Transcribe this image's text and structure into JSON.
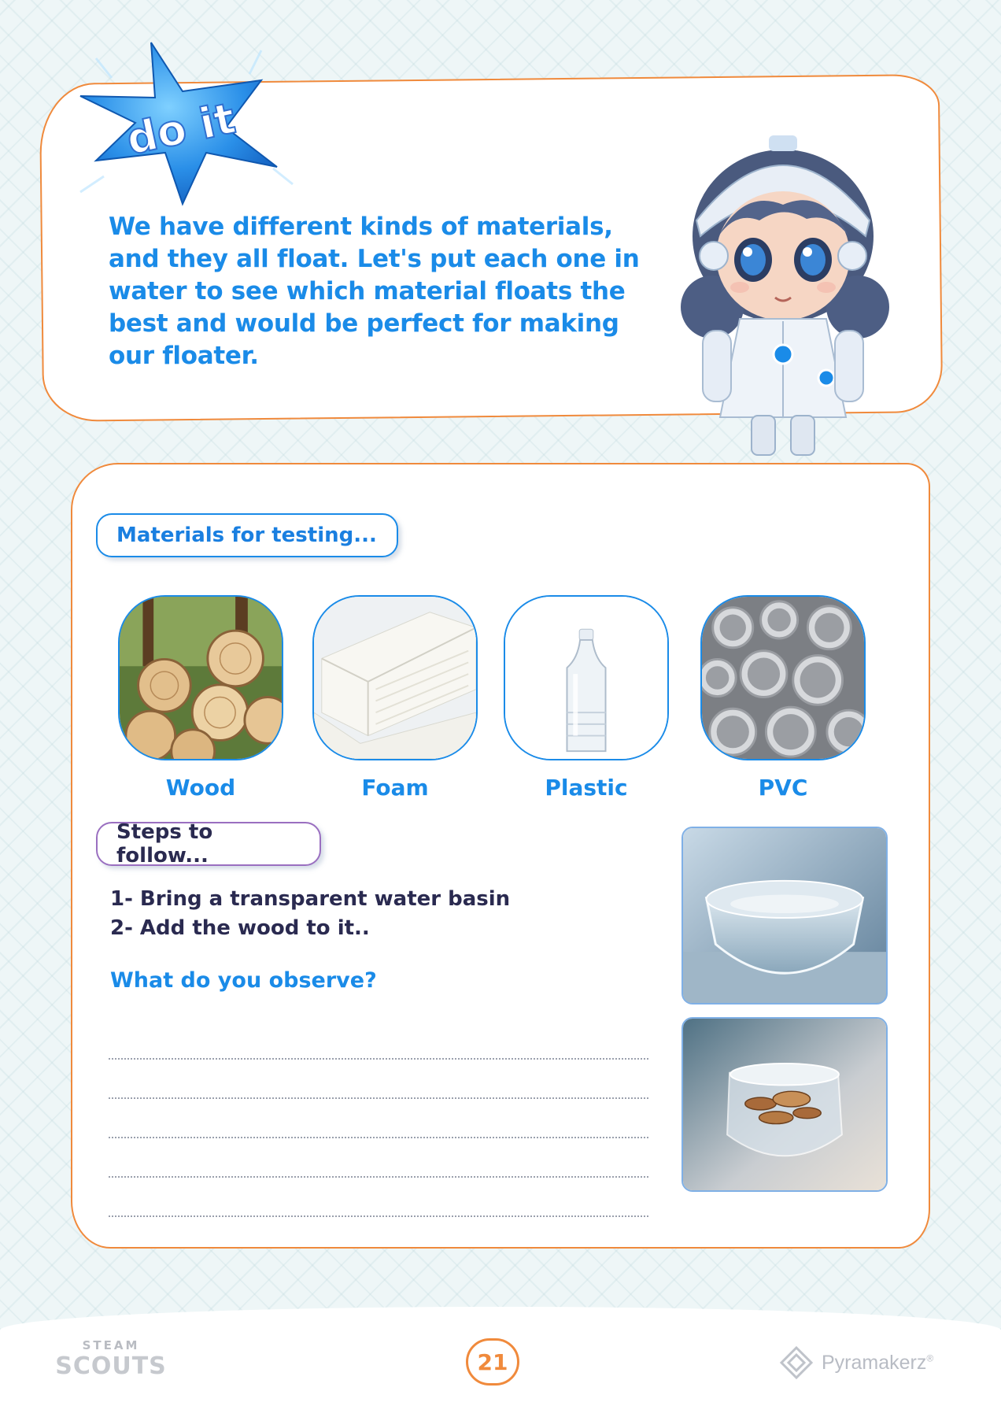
{
  "badge": {
    "label": "do it"
  },
  "intro": {
    "text": "We have different kinds of materials, and they all float. Let's put each one in water to see which material floats the best and would be perfect for making our floater."
  },
  "materials_section": {
    "title": "Materials for testing...",
    "items": [
      {
        "label": "Wood"
      },
      {
        "label": "Foam"
      },
      {
        "label": "Plastic"
      },
      {
        "label": "PVC"
      }
    ]
  },
  "steps_section": {
    "title": "Steps to follow...",
    "steps": [
      "1- Bring a transparent water basin",
      "2- Add the wood to it.."
    ],
    "question": "What do you observe?"
  },
  "footer": {
    "left_logo_top": "STEAM",
    "left_logo_bottom": "SCOUTS",
    "page_number": "21",
    "right_logo": "Pyramakerz",
    "right_logo_mark": "®"
  },
  "colors": {
    "accent_blue": "#1a8be8",
    "accent_orange": "#f08a3c",
    "dark_text": "#2a2a50"
  }
}
